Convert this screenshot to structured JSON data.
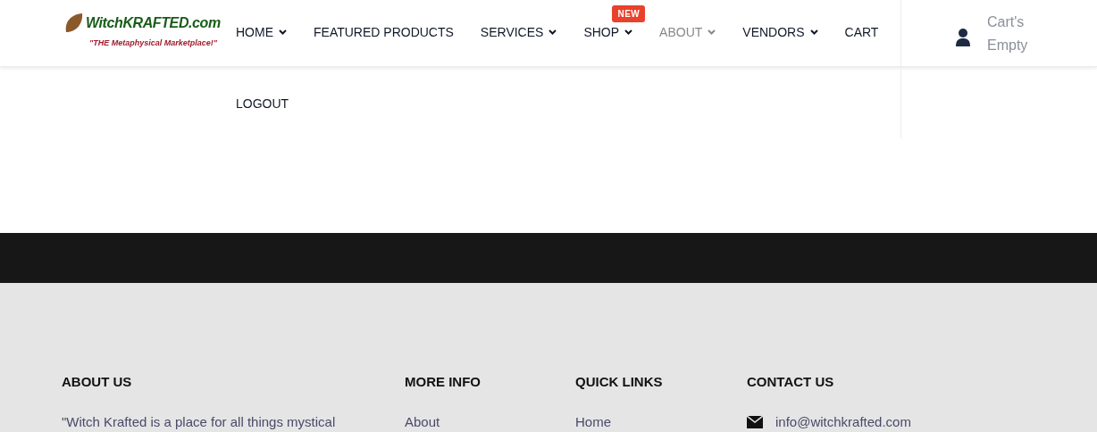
{
  "logo": {
    "name": "WitchKRAFTED.com",
    "tagline": "\"THE Metaphysical Marketplace!\""
  },
  "nav": [
    {
      "label": "HOME",
      "dropdown": true,
      "selected": false
    },
    {
      "label": "FEATURED PRODUCTS",
      "dropdown": false,
      "selected": false
    },
    {
      "label": "SERVICES",
      "dropdown": true,
      "selected": false
    },
    {
      "label": "SHOP",
      "dropdown": true,
      "selected": false,
      "badge": "NEW"
    },
    {
      "label": "ABOUT",
      "dropdown": true,
      "selected": true
    },
    {
      "label": "VENDORS",
      "dropdown": true,
      "selected": false
    },
    {
      "label": "CART",
      "dropdown": false,
      "selected": false
    },
    {
      "label": "LOGOUT",
      "dropdown": false,
      "selected": false
    }
  ],
  "cart": {
    "line_1": "Cart's",
    "line_2": "Empty"
  },
  "footer": [
    {
      "heading": "ABOUT US",
      "first_line": "\"Witch Krafted is a place for all things mystical"
    },
    {
      "heading": "MORE INFO",
      "first_line": "About"
    },
    {
      "heading": "QUICK LINKS",
      "first_line": "Home"
    },
    {
      "heading": "CONTACT US",
      "first_line": "info@witchkrafted.com",
      "kind": "email"
    }
  ]
}
